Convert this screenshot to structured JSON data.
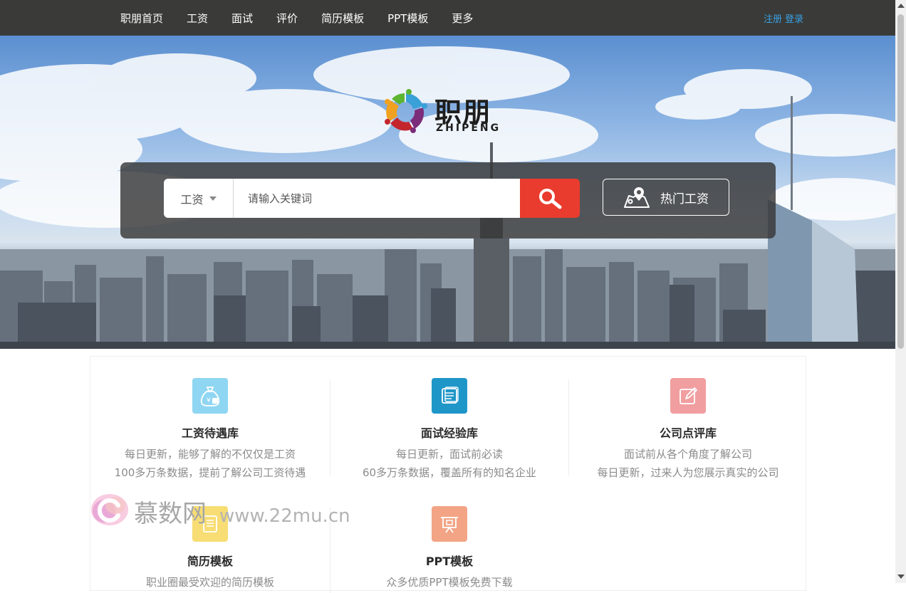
{
  "nav": {
    "items": [
      "职朋首页",
      "工资",
      "面试",
      "评价",
      "简历模板",
      "PPT模板",
      "更多"
    ],
    "register": "注册",
    "login": "登录"
  },
  "logo": {
    "cn": "职朋",
    "en": "ZHIPENG"
  },
  "search": {
    "type_selected": "工资",
    "placeholder": "请输入关键词",
    "button_icon": "search-icon",
    "hot_label": "热门工资",
    "hot_icon": "map-pin-icon"
  },
  "features": [
    {
      "title": "工资待遇库",
      "line1": "每日更新，能够了解的不仅仅是工资",
      "line2": "100多万条数据，提前了解公司工资待遇",
      "icon": "money-bag-icon",
      "color": "#8fd6f2"
    },
    {
      "title": "面试经验库",
      "line1": "每日更新，面试前必读",
      "line2": "60多万条数据，覆盖所有的知名企业",
      "icon": "book-icon",
      "color": "#1f96c8"
    },
    {
      "title": "公司点评库",
      "line1": "面试前从各个角度了解公司",
      "line2": "每日更新，过来人为您展示真实的公司",
      "icon": "edit-icon",
      "color": "#f19ea0"
    },
    {
      "title": "简历模板",
      "line1": "职业圈最受欢迎的简历模板",
      "line2": "",
      "icon": "resume-icon",
      "color": "#f7dd73"
    },
    {
      "title": "PPT模板",
      "line1": "众多优质PPT模板免费下载",
      "line2": "",
      "icon": "presentation-icon",
      "color": "#f2a485"
    }
  ],
  "watermark": {
    "text": "慕数网",
    "url": "www.22mu.cn"
  }
}
